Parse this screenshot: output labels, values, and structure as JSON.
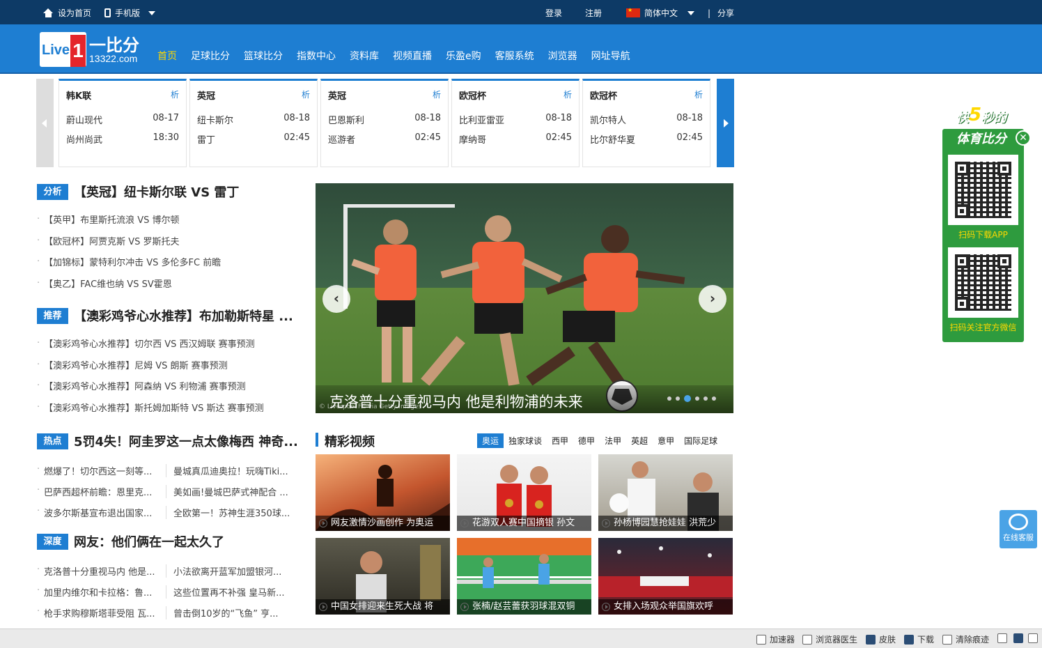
{
  "topbar": {
    "set_home": "设为首页",
    "mobile": "手机版",
    "login": "登录",
    "register": "注册",
    "language": "简体中文",
    "share": "分享"
  },
  "logo": {
    "name": "一比分",
    "url": "13322.com",
    "live": "Live",
    "one": "1"
  },
  "nav": [
    "首页",
    "足球比分",
    "篮球比分",
    "指数中心",
    "资料库",
    "视频直播",
    "乐盈e购",
    "客服系统",
    "浏览器",
    "网址导航"
  ],
  "matches": [
    {
      "league": "韩K联",
      "analysis": "析",
      "team1": "蔚山现代",
      "team2": "尚州尚武",
      "date": "08-17",
      "time": "18:30"
    },
    {
      "league": "英冠",
      "analysis": "析",
      "team1": "纽卡斯尔",
      "team2": "雷丁",
      "date": "08-18",
      "time": "02:45"
    },
    {
      "league": "英冠",
      "analysis": "析",
      "team1": "巴恩斯利",
      "team2": "巡游者",
      "date": "08-18",
      "time": "02:45"
    },
    {
      "league": "欧冠杯",
      "analysis": "析",
      "team1": "比利亚雷亚",
      "team2": "摩纳哥",
      "date": "08-18",
      "time": "02:45"
    },
    {
      "league": "欧冠杯",
      "analysis": "析",
      "team1": "凯尔特人",
      "team2": "比尔舒华夏",
      "date": "08-18",
      "time": "02:45"
    }
  ],
  "analysis": {
    "tag": "分析",
    "title": "【英冠】纽卡斯尔联 VS 雷丁",
    "items": [
      "【英甲】布里斯托流浪 VS 博尔顿",
      "【欧冠杯】阿贾克斯 VS 罗斯托夫",
      "【加锦标】蒙特利尔冲击 VS 多伦多FC 前瞻",
      "【奥乙】FAC维也纳 VS SV霍恩"
    ]
  },
  "recommend": {
    "tag": "推荐",
    "title": "【澳彩鸡爷心水推荐】布加勒斯特星 ...",
    "items": [
      "【澳彩鸡爷心水推荐】切尔西 VS 西汉姆联 赛事预测",
      "【澳彩鸡爷心水推荐】尼姆 VS 朗斯 赛事预测",
      "【澳彩鸡爷心水推荐】阿森纳 VS 利物浦 赛事预测",
      "【澳彩鸡爷心水推荐】斯托姆加斯特 VS 斯达 赛事预测"
    ]
  },
  "hot": {
    "tag": "热点",
    "title": "5罚4失！阿圭罗这一点太像梅西 神奇...",
    "rows": [
      [
        "燃爆了！切尔西这一刻等...",
        "曼城真瓜迪奥拉！玩嗨Tiki..."
      ],
      [
        "巴萨西超杯前瞻：恩里克...",
        "美如画!曼城巴萨式神配合 ..."
      ],
      [
        "波多尔斯基宣布退出国家...",
        "全欧第一！苏神生涯350球..."
      ]
    ]
  },
  "depth": {
    "tag": "深度",
    "title": "网友：他们俩在一起太久了",
    "rows": [
      [
        "克洛普十分重视马内 他是...",
        "小法欲离开蓝军加盟银河..."
      ],
      [
        "加里内维尔和卡拉格：鲁...",
        "这些位置再不补强 皇马新..."
      ],
      [
        "枪手求购穆斯塔菲受阻 瓦...",
        "曾击倒10岁的“飞鱼” 亨..."
      ]
    ]
  },
  "slider": {
    "caption": "克洛普十分重视马内 他是利物浦的未来",
    "watermark": "© Liverpool FC via Getty Images",
    "slide_count": 6,
    "active_slide": 3
  },
  "videos": {
    "title": "精彩视频",
    "tabs": [
      "奥运",
      "独家球谈",
      "西甲",
      "德甲",
      "法甲",
      "英超",
      "意甲",
      "国际足球"
    ],
    "active_tab": "奥运",
    "items": [
      "网友激情沙画创作 为奥运",
      "花游双人赛中国摘银 孙文",
      "孙杨博园慧抢娃娃 洪荒少",
      "中国女排迎来生死大战 将",
      "张楠/赵芸蕾获羽球混双铜",
      "女排入场观众举国旗欢呼"
    ]
  },
  "promo": {
    "fast": "快",
    "seconds": "5",
    "secs_text": "秒的",
    "line2": "体育比分",
    "close": "✕",
    "qr1_label": "扫码下载APP",
    "qr2_label": "扫码关注官方微信"
  },
  "service": {
    "label": "在线客服"
  },
  "statusbar": [
    "加速器",
    "浏览器医生",
    "皮肤",
    "下载",
    "清除痕迹"
  ],
  "colors": {
    "brand_blue": "#1e7ed2",
    "top_navy": "#0d3a66",
    "promo_green": "#2e9b3e",
    "nav_active": "#ffd800"
  }
}
